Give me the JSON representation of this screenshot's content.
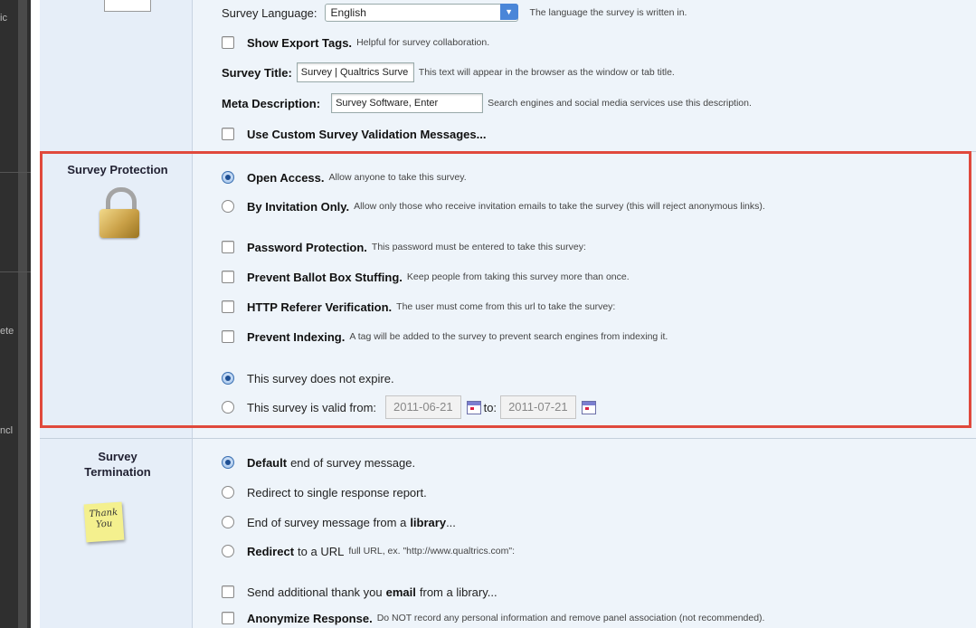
{
  "left_strip": {
    "cut_labels": [
      "ic",
      "ete",
      "ncl"
    ]
  },
  "general": {
    "survey_language_label": "Survey Language:",
    "survey_language_value": "English",
    "survey_language_help": "The language the survey is written in.",
    "show_export_tags_label": "Show Export Tags.",
    "show_export_tags_help": "Helpful for survey collaboration.",
    "survey_title_label": "Survey Title:",
    "survey_title_value": "Survey | Qualtrics Surve",
    "survey_title_help": "This text will appear in the browser as the window or tab title.",
    "meta_description_label": "Meta Description:",
    "meta_description_value": "Survey Software, Enter",
    "meta_description_help": "Search engines and social media services use this description.",
    "custom_validation_label": "Use Custom Survey Validation Messages..."
  },
  "protection": {
    "section_label": "Survey Protection",
    "open_access_label": "Open Access.",
    "open_access_help": "Allow anyone to take this survey.",
    "by_invitation_label": "By Invitation Only.",
    "by_invitation_help": "Allow only those who receive invitation emails to take the survey (this will reject anonymous links).",
    "password_label": "Password Protection.",
    "password_help": "This password must be entered to take this survey:",
    "ballot_label": "Prevent Ballot Box Stuffing.",
    "ballot_help": "Keep people from taking this survey more than once.",
    "referer_label": "HTTP Referer Verification.",
    "referer_help": "The user must come from this url to take the survey:",
    "indexing_label": "Prevent Indexing.",
    "indexing_help": "A tag will be added to the survey to prevent search engines from indexing it.",
    "not_expire_label": "This survey does not expire.",
    "valid_from_label": "This survey is valid from:",
    "valid_from_date": "2011-06-21",
    "to_label": "to:",
    "valid_to_date": "2011-07-21"
  },
  "termination": {
    "section_label_line1": "Survey",
    "section_label_line2": "Termination",
    "note_text_line1": "Thank",
    "note_text_line2": "You",
    "default_bold": "Default",
    "default_rest": "end of survey message.",
    "redirect_report_label": "Redirect to single response report.",
    "library_message_prefix": "End of survey message from a",
    "library_message_bold": "library",
    "library_message_suffix": "...",
    "redirect_url_bold": "Redirect",
    "redirect_url_rest": "to a URL",
    "redirect_url_help": "full URL, ex. \"http://www.qualtrics.com\":",
    "thankyou_prefix": "Send additional thank you",
    "thankyou_bold": "email",
    "thankyou_suffix": "from a library...",
    "anonymize_label": "Anonymize Response.",
    "anonymize_help": "Do NOT record any personal information and remove panel association (not recommended)."
  },
  "colors": {
    "highlight_border": "#e0493c",
    "radio_selected": "#1e4f93",
    "panel_bg": "#eef4fa"
  },
  "icons": [
    "padlock-icon",
    "thank-you-note-icon",
    "calendar-icon",
    "dropdown-arrow-icon"
  ]
}
